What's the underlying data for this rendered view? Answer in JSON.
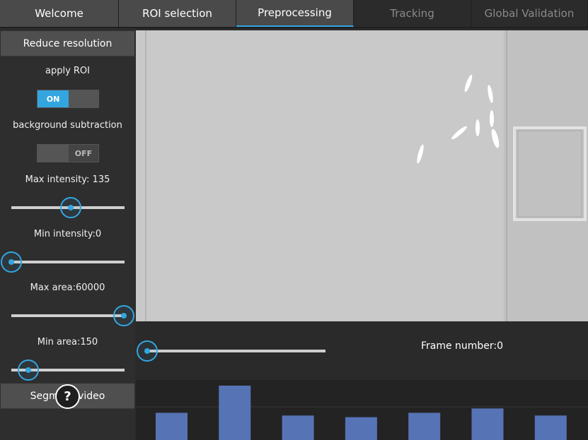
{
  "tabs": [
    {
      "label": "Welcome",
      "state": "normal"
    },
    {
      "label": "ROI selection",
      "state": "normal"
    },
    {
      "label": "Preprocessing",
      "state": "active"
    },
    {
      "label": "Tracking",
      "state": "disabled"
    },
    {
      "label": "Global Validation",
      "state": "disabled"
    }
  ],
  "left_panel": {
    "reduce_resolution_label": "Reduce resolution",
    "apply_roi_label": "apply ROI",
    "apply_roi_switch": {
      "on_text": "ON",
      "state": true
    },
    "bg_subtraction_label": "background subtraction",
    "bg_subtraction_switch": {
      "off_text": "OFF",
      "state": false
    },
    "max_intensity_label": "Max intensity: 135",
    "max_intensity_value": 135,
    "min_intensity_label": "Min intensity:0",
    "min_intensity_value": 0,
    "max_area_label": "Max area:60000",
    "max_area_value": 60000,
    "min_area_label": "Min area:150",
    "min_area_value": 150,
    "segment_video_label": "Segment video",
    "help_icon_text": "?"
  },
  "video": {
    "frame_label": "Frame number:0",
    "frame_value": 0,
    "slider_fraction": 0.0
  },
  "histogram": {
    "values": [
      0.5,
      1.0,
      0.45,
      0.42,
      0.5,
      0.58,
      0.45
    ],
    "bar_color": "#5673b5"
  },
  "colors": {
    "accent": "#33a6e0",
    "panel": "#2e2e2e",
    "button": "#4f4f4f"
  }
}
